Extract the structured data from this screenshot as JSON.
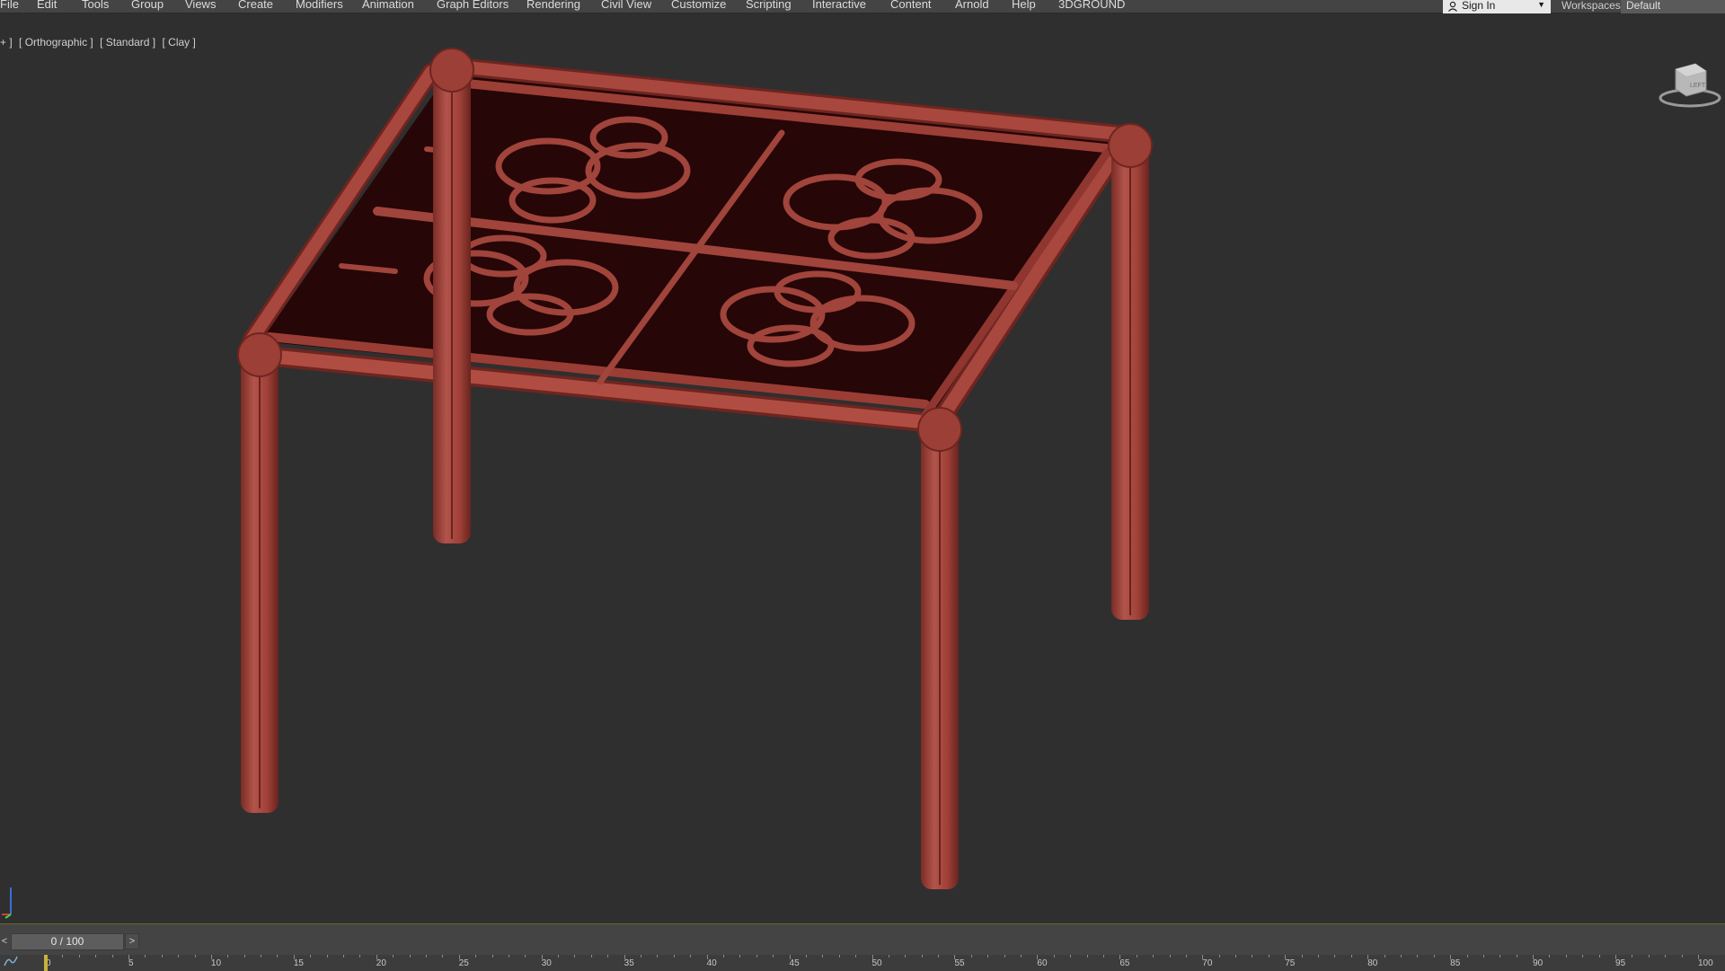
{
  "menubar": {
    "items": [
      "File",
      "Edit",
      "Tools",
      "Group",
      "Views",
      "Create",
      "Modifiers",
      "Animation",
      "Graph Editors",
      "Rendering",
      "Civil View",
      "Customize",
      "Scripting",
      "Interactive",
      "Content",
      "Arnold",
      "Help",
      "3DGROUND"
    ],
    "sign_in_label": "Sign In",
    "workspaces_label": "Workspaces:",
    "workspaces_value": "Default"
  },
  "viewport": {
    "label_prefix": "+ ]",
    "view": "[ Orthographic ]",
    "shading": "[ Standard ]",
    "style": "[ Clay ]",
    "viewcube_face": "LEFT"
  },
  "timeline": {
    "frame_display": "0 / 100",
    "prev_label": "<",
    "next_label": ">",
    "ruler_ticks": [
      "0",
      "5",
      "10",
      "15",
      "20",
      "25",
      "30",
      "35",
      "40",
      "45",
      "50",
      "55",
      "60",
      "65",
      "70",
      "75",
      "80",
      "85",
      "90",
      "95",
      "100"
    ]
  },
  "colors": {
    "model": "#a0443c",
    "model_shadow": "#6e2520",
    "glass_top": "#2a0707",
    "viewport_bg": "#2f2f2f"
  }
}
